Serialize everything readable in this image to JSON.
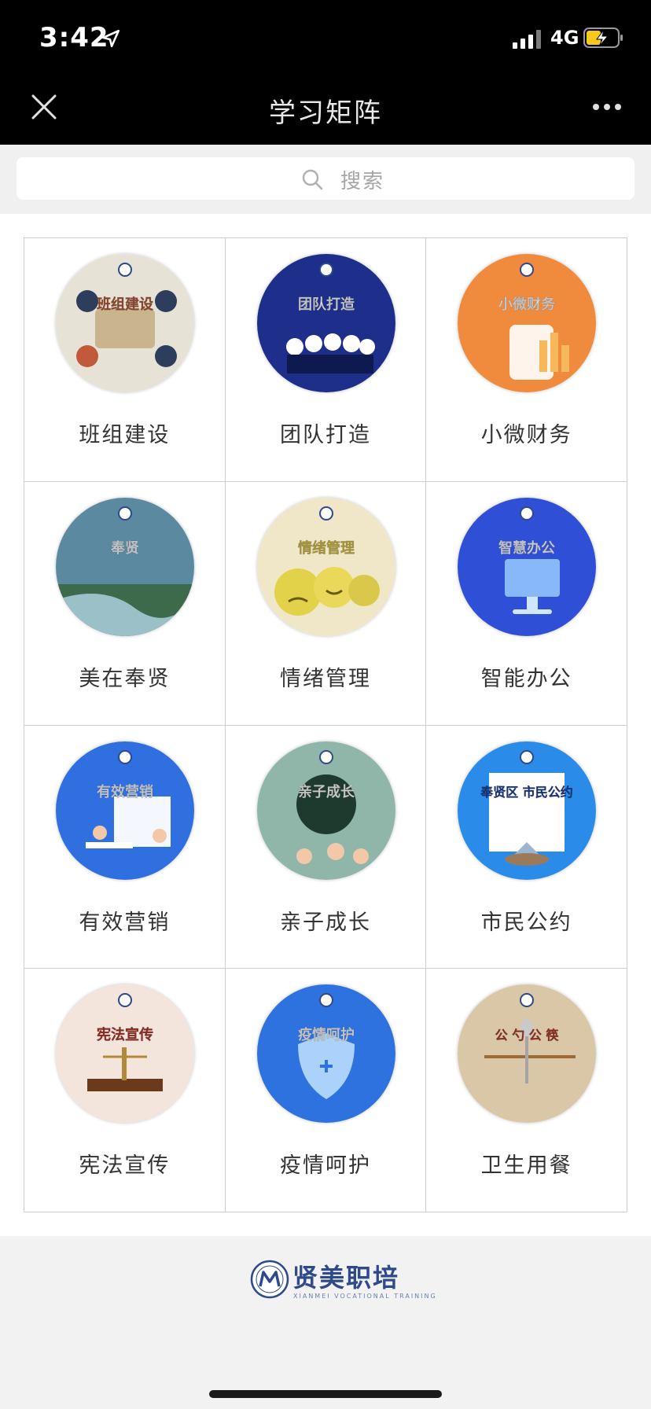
{
  "status_bar": {
    "time": "3:42",
    "network": "4G"
  },
  "nav": {
    "title": "学习矩阵"
  },
  "search": {
    "placeholder": "搜索"
  },
  "tiles": [
    {
      "label": "班组建设",
      "image_text": "班组建设",
      "bg": "#e7e2d6",
      "accent": "#b55a3a",
      "icon": "team-building-icon"
    },
    {
      "label": "团队打造",
      "image_text": "团队打造",
      "bg": "#1d2f8a",
      "accent": "#ffffff",
      "icon": "team-icon"
    },
    {
      "label": "小微财务",
      "image_text": "小微财务",
      "bg": "#f08a3c",
      "accent": "#ffffff",
      "icon": "finance-icon"
    },
    {
      "label": "美在奉贤",
      "image_text": "奉贤",
      "bg": "#5b8aa0",
      "accent": "#ffffff",
      "icon": "landscape-icon"
    },
    {
      "label": "情绪管理",
      "image_text": "情绪管理",
      "bg": "#f0e7c8",
      "accent": "#d8c24a",
      "icon": "emotion-icon"
    },
    {
      "label": "智能办公",
      "image_text": "智慧办公",
      "bg": "#2f4fd6",
      "accent": "#ffffff",
      "icon": "computer-icon"
    },
    {
      "label": "有效营销",
      "image_text": "有效营销",
      "bg": "#2f6fe0",
      "accent": "#ffffff",
      "icon": "marketing-icon"
    },
    {
      "label": "亲子成长",
      "image_text": "亲子成长",
      "bg": "#8fb6a8",
      "accent": "#ffffff",
      "icon": "family-icon"
    },
    {
      "label": "市民公约",
      "image_text": "奉贤区 市民公约",
      "bg": "#2a8ce8",
      "accent": "#1d3f9a",
      "icon": "house-icon"
    },
    {
      "label": "宪法宣传",
      "image_text": "宪法宣传",
      "bg": "#f3e4dc",
      "accent": "#b03a2e",
      "icon": "scales-icon"
    },
    {
      "label": "疫情呵护",
      "image_text": "疫情呵护",
      "bg": "#2e72e0",
      "accent": "#ffffff",
      "icon": "shield-icon"
    },
    {
      "label": "卫生用餐",
      "image_text": "公 勺 公 筷",
      "bg": "#d9c7a8",
      "accent": "#b03a2e",
      "icon": "chopsticks-icon"
    }
  ],
  "footer": {
    "brand": "贤美职培",
    "brand_sub": "XIANMEI VOCATIONAL TRAINING"
  }
}
